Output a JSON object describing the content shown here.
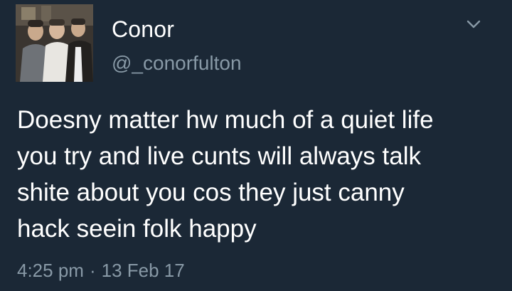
{
  "tweet": {
    "display_name": "Conor",
    "handle": "@_conorfulton",
    "text": "Doesny matter hw much of a quiet life\nyou try and live cunts will always talk\nshite about you cos they just canny\nhack seein folk happy",
    "time": "4:25 pm",
    "separator": "·",
    "date": "13 Feb 17"
  },
  "icons": {
    "menu": "chevron-down-icon"
  },
  "colors": {
    "background": "#1b2836",
    "primary_text": "#ffffff",
    "secondary_text": "#8899a6"
  }
}
